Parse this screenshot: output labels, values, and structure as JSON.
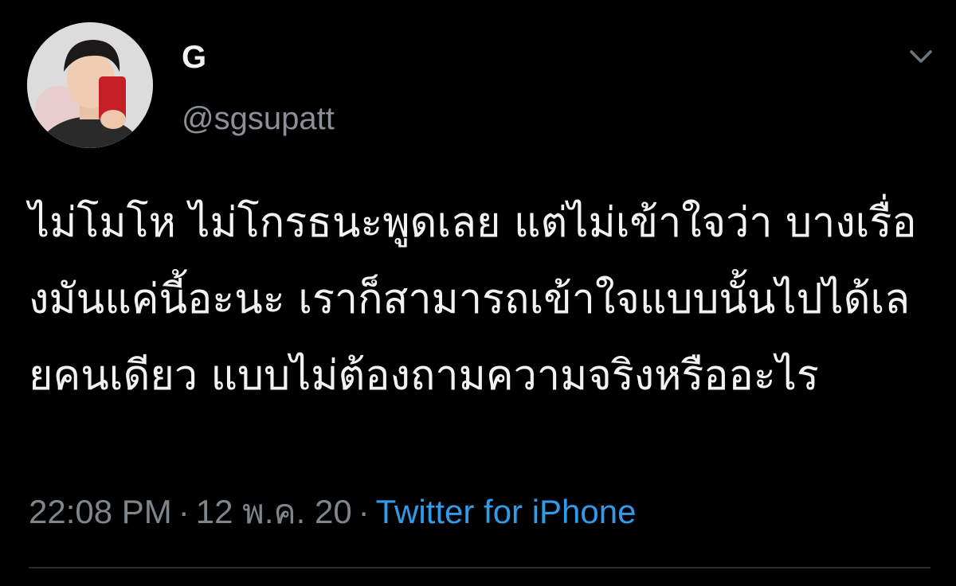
{
  "tweet": {
    "author": {
      "display_name": "G",
      "handle": "@sgsupatt",
      "avatar_icon": "profile-photo"
    },
    "more_options_icon": "chevron-down-icon",
    "text": "ไม่โมโห ไม่โกรธนะพูดเลย แต่ไม่เข้าใจว่า บางเรื่องมันแค่นี้อะนะ เราก็สามารถเข้าใจแบบนั้นไปได้เลยคนเดียว แบบไม่ต้องถามความจริงหรืออะไร",
    "meta": {
      "time": "22:08 PM",
      "separator": "·",
      "date": "12 พ.ค. 20",
      "source": "Twitter for iPhone"
    },
    "colors": {
      "background": "#000000",
      "text": "#f2f2f2",
      "muted": "#7e868c",
      "link": "#2f9bea"
    }
  }
}
